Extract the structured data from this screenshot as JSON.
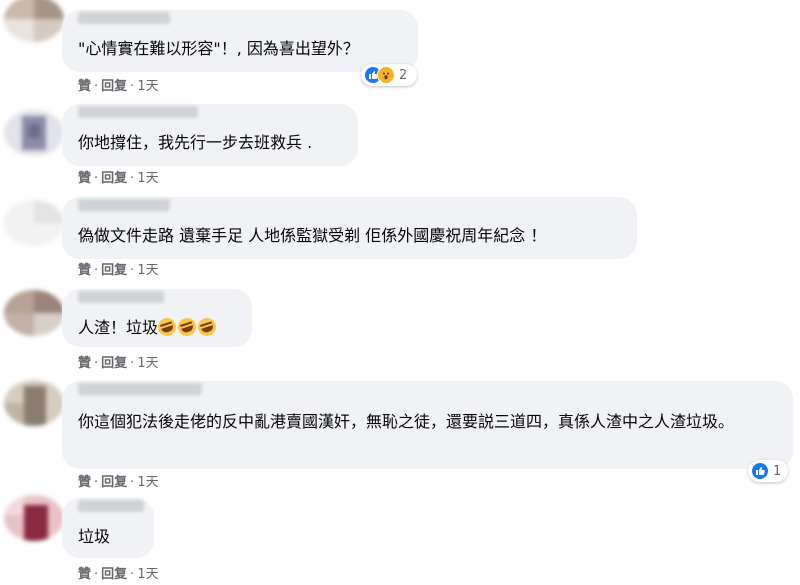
{
  "comments": [
    {
      "text": "\"心情實在難以形容\"！, 因為喜出望外？",
      "actions": {
        "like": "贊",
        "reply": "回复",
        "time": "1天"
      },
      "reaction_count": "2"
    },
    {
      "text": "你地撐住，我先行一步去班救兵 .",
      "actions": {
        "like": "贊",
        "reply": "回复",
        "time": "1天"
      }
    },
    {
      "text": "偽做文件走路 遺棄手足 人地係監獄受剃 佢係外國慶祝周年紀念 ！",
      "actions": {
        "like": "贊",
        "reply": "回复",
        "time": "1天"
      }
    },
    {
      "text": "人渣！垃圾",
      "actions": {
        "like": "贊",
        "reply": "回复",
        "time": "1天"
      }
    },
    {
      "text": "你這個犯法後走佬的反中亂港賣國漢奸，無恥之徒，還要説三道四，真係人渣中之人渣垃圾。",
      "actions": {
        "like": "贊",
        "reply": "回复",
        "time": "1天"
      },
      "reaction_count": "1"
    },
    {
      "text": "垃圾",
      "actions": {
        "like": "贊",
        "reply": "回复",
        "time": "1天"
      }
    }
  ],
  "colors": {
    "bubble": "#f0f2f5",
    "like_blue": "#1877f2",
    "wow_yellow": "#f7b125",
    "meta_gray": "#65676b"
  },
  "icons": {
    "like": "thumbs-up-icon",
    "wow": "wow-face-icon",
    "laugh": "rolling-laugh-emoji"
  }
}
